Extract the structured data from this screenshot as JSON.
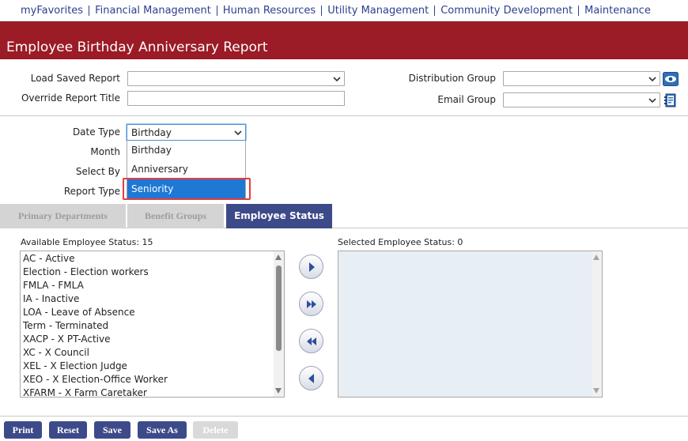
{
  "nav": {
    "items": [
      "myFavorites",
      "Financial Management",
      "Human Resources",
      "Utility Management",
      "Community Development",
      "Maintenance"
    ]
  },
  "page": {
    "title": "Employee Birthday Anniversary Report"
  },
  "report_header": {
    "load_saved_label": "Load Saved Report",
    "load_saved_value": "",
    "override_title_label": "Override Report Title",
    "override_title_value": "",
    "distribution_group_label": "Distribution Group",
    "distribution_group_value": "",
    "email_group_label": "Email Group",
    "email_group_value": ""
  },
  "criteria": {
    "date_type_label": "Date Type",
    "date_type_value": "Birthday",
    "month_label": "Month",
    "select_by_label": "Select By",
    "report_type_label": "Report Type",
    "date_type_options": [
      "Birthday",
      "Anniversary",
      "Seniority"
    ],
    "highlighted_option": "Seniority"
  },
  "tabs": [
    {
      "label": "Primary Departments",
      "active": false
    },
    {
      "label": "Benefit Groups",
      "active": false
    },
    {
      "label": "Employee Status",
      "active": true
    }
  ],
  "available": {
    "label": "Available Employee Status: 15",
    "items": [
      "AC - Active",
      "Election - Election workers",
      "FMLA - FMLA",
      "IA - Inactive",
      "LOA - Leave of Absence",
      "Term - Terminated",
      "XACP - X PT-Active",
      "XC - X Council",
      "XEL - X Election Judge",
      "XEO - X Election-Office Worker",
      "XFARM - X Farm Caretaker"
    ]
  },
  "selected": {
    "label": "Selected Employee Status: 0",
    "items": []
  },
  "move_buttons": [
    "move-right-icon",
    "move-all-right-icon",
    "move-all-left-icon",
    "move-left-icon"
  ],
  "buttons": {
    "print": "Print",
    "reset": "Reset",
    "save": "Save",
    "save_as": "Save As",
    "delete": "Delete"
  },
  "colors": {
    "brand_red": "#9b1b26",
    "nav_blue": "#2d3f8f",
    "button_blue": "#3d4a8a",
    "selection_blue": "#1e78d4",
    "highlight_red": "#e53d3d"
  }
}
